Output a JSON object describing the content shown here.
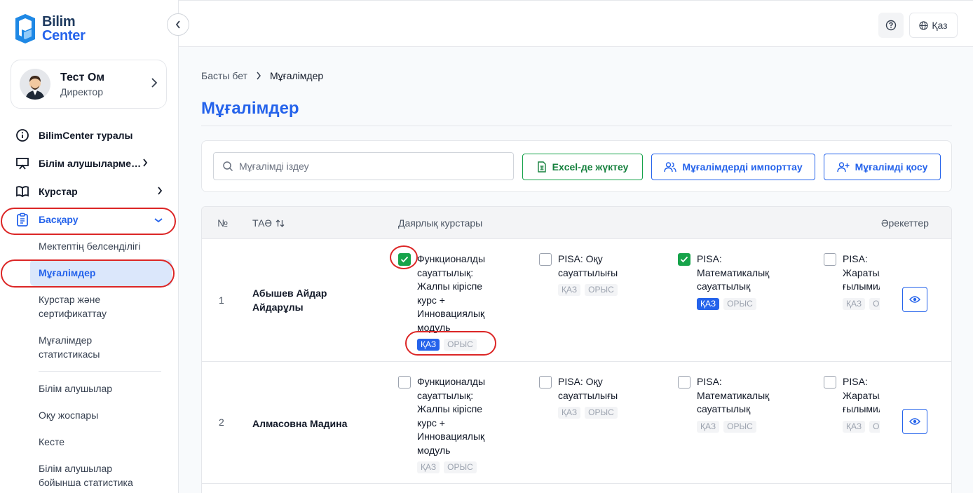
{
  "brand": {
    "line1": "Bilim",
    "line2": "Center"
  },
  "profile": {
    "name": "Тест Ом",
    "role": "Директор"
  },
  "nav": {
    "items": [
      {
        "label": "BilimCenter туралы"
      },
      {
        "label": "Білім алушылармен жұмыс"
      },
      {
        "label": "Курстар"
      },
      {
        "label": "Басқару"
      }
    ],
    "sub": [
      {
        "label": "Мектептің белсенділігі"
      },
      {
        "label": "Мұғалімдер"
      },
      {
        "label": "Курстар және сертификаттау"
      },
      {
        "label": "Мұғалімдер статистикасы"
      },
      {
        "label": "Білім алушылар"
      },
      {
        "label": "Оқу жоспары"
      },
      {
        "label": "Кесте"
      },
      {
        "label": "Білім алушылар бойынша статистика"
      }
    ]
  },
  "header": {
    "lang": "Қаз"
  },
  "breadcrumb": {
    "home": "Басты бет",
    "current": "Мұғалімдер"
  },
  "page": {
    "title": "Мұғалімдер"
  },
  "toolbar": {
    "search_placeholder": "Мұғалімді іздеу",
    "excel": "Excel-де жүктеу",
    "import": "Мұғалімдерді импорттау",
    "add": "Мұғалімді қосу"
  },
  "table": {
    "headers": {
      "num": "№",
      "name": "ТАӘ",
      "courses": "Даярлық курстары",
      "actions": "Әрекеттер"
    },
    "rows": [
      {
        "num": "1",
        "name": "Абышев Айдар Айдарұлы",
        "courses": [
          {
            "title": "Функционалды сауаттылық: Жалпы кіріспе курс + Инновациялық модуль",
            "checked": true,
            "tags": [
              "ҚАЗ",
              "ОРЫС"
            ],
            "active_tag": "ҚАЗ"
          },
          {
            "title": "PISA: Оқу сауаттылығы",
            "checked": false,
            "tags": [
              "ҚАЗ",
              "ОРЫС"
            ],
            "active_tag": ""
          },
          {
            "title": "PISA: Математикалық сауаттылық",
            "checked": true,
            "tags": [
              "ҚАЗ",
              "ОРЫС"
            ],
            "active_tag": "ҚАЗ"
          },
          {
            "title": "PISA: Жаратылыстану ғылымилық",
            "checked": false,
            "tags": [
              "ҚАЗ",
              "ОРЫС"
            ],
            "active_tag": ""
          }
        ]
      },
      {
        "num": "2",
        "name": "Алмасовна Мадина",
        "courses": [
          {
            "title": "Функционалды сауаттылық: Жалпы кіріспе курс + Инновациялық модуль",
            "checked": false,
            "tags": [
              "ҚАЗ",
              "ОРЫС"
            ],
            "active_tag": ""
          },
          {
            "title": "PISA: Оқу сауаттылығы",
            "checked": false,
            "tags": [
              "ҚАЗ",
              "ОРЫС"
            ],
            "active_tag": ""
          },
          {
            "title": "PISA: Математикалық сауаттылық",
            "checked": false,
            "tags": [
              "ҚАЗ",
              "ОРЫС"
            ],
            "active_tag": ""
          },
          {
            "title": "PISA: Жаратылыстану ғылымилық",
            "checked": false,
            "tags": [
              "ҚАЗ",
              "ОРЫС"
            ],
            "active_tag": ""
          }
        ]
      }
    ]
  },
  "colors": {
    "accent": "#2563eb",
    "success": "#16a34a",
    "highlight": "#dc2626"
  }
}
